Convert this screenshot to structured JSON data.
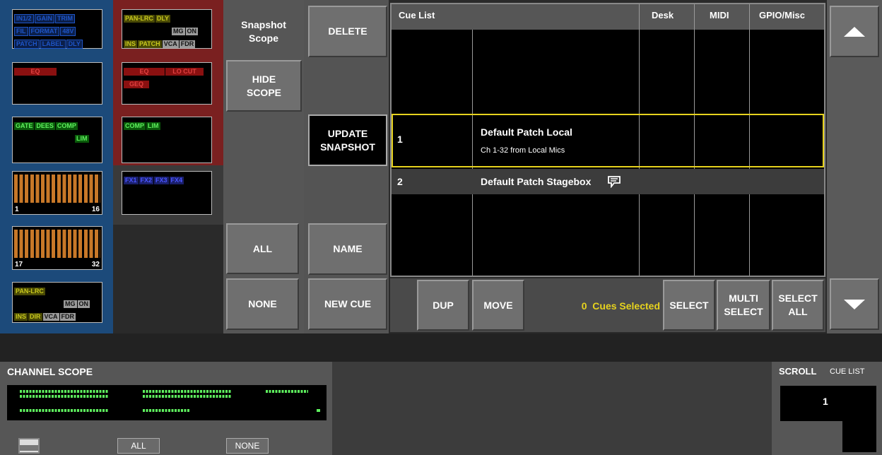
{
  "snapshot_scope": {
    "title": "Snapshot Scope",
    "hide_scope": "HIDE SCOPE",
    "all": "ALL",
    "none": "NONE"
  },
  "channel_tiles": {
    "t1": [
      "IN1/2",
      "GAIN",
      "TRIM",
      "FIL",
      "FORMAT",
      "48V",
      "PATCH",
      "LABEL",
      "DLY"
    ],
    "t2": [
      "EQ"
    ],
    "t3": [
      "GATE",
      "DEES",
      "COMP",
      "LIM"
    ],
    "t4": {
      "start": "1",
      "end": "16"
    },
    "t5": {
      "start": "17",
      "end": "32"
    },
    "t6": [
      "PAN-LRC",
      "MG",
      "ON",
      "INS",
      "DIR",
      "VCA",
      "FDR"
    ]
  },
  "bus_tiles": {
    "b1": [
      "PAN-LRC",
      "DLY",
      "MG",
      "ON",
      "INS",
      "PATCH",
      "VCA",
      "FDR"
    ],
    "b2": [
      "EQ",
      "LO CUT",
      "GEQ"
    ],
    "b3": [
      "COMP",
      "LIM"
    ],
    "b4": [
      "FX1",
      "FX2",
      "FX3",
      "FX4"
    ]
  },
  "actions": {
    "delete": "DELETE",
    "update_snapshot": "UPDATE SNAPSHOT",
    "name": "NAME",
    "new_cue": "NEW CUE"
  },
  "cue_list": {
    "headers": {
      "title": "Cue List",
      "desk": "Desk",
      "midi": "MIDI",
      "gpio": "GPIO/Misc"
    },
    "rows": [
      {
        "num": "1",
        "name": "Default Patch Local",
        "desc": "Ch 1-32 from Local Mics"
      },
      {
        "num": "2",
        "name": "Default Patch Stagebox",
        "desc": ""
      }
    ]
  },
  "bottom_bar": {
    "dup": "DUP",
    "move": "MOVE",
    "cues_selected": "0  Cues Selected",
    "select": "SELECT",
    "multi_select": "MULTI SELECT",
    "select_all": "SELECT ALL"
  },
  "channel_scope": {
    "title": "CHANNEL SCOPE",
    "all": "ALL",
    "none": "NONE"
  },
  "scroll": {
    "title": "SCROLL",
    "subtitle": "CUE LIST",
    "value": "1"
  },
  "colors": {
    "blue_panel": "#1c4a7a",
    "red_panel": "#7a2020",
    "highlight": "#e6d21e",
    "led_green": "#5ef05e"
  }
}
